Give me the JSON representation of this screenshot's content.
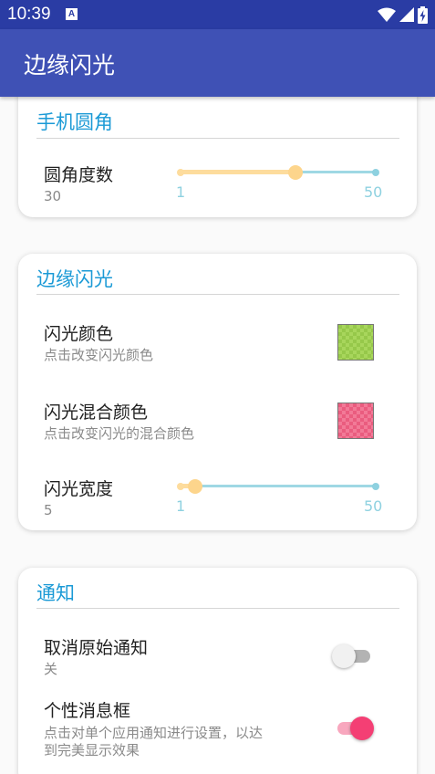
{
  "status_bar": {
    "time": "10:39",
    "notification_glyph": "A"
  },
  "app_bar": {
    "title": "边缘闪光"
  },
  "sections": {
    "corner": {
      "header": "手机圆角",
      "corner_degree": {
        "title": "圆角度数",
        "value": "30",
        "min": "1",
        "max": "50",
        "fraction": 0.59
      }
    },
    "edge_flash": {
      "header": "边缘闪光",
      "flash_color": {
        "title": "闪光颜色",
        "subtitle": "点击改变闪光颜色",
        "color": "#96c84a"
      },
      "mix_color": {
        "title": "闪光混合颜色",
        "subtitle": "点击改变闪光的混合颜色",
        "color": "#ea5c7f"
      },
      "flash_width": {
        "title": "闪光宽度",
        "value": "5",
        "min": "1",
        "max": "50",
        "fraction": 0.08
      }
    },
    "notification": {
      "header": "通知",
      "cancel_original": {
        "title": "取消原始通知",
        "subtitle": "关",
        "on": false
      },
      "custom_box": {
        "title": "个性消息框",
        "subtitle_line1": "点击对单个应用通知进行设置，以达",
        "subtitle_line2": "到完美显示效果",
        "on": true
      }
    }
  },
  "colors": {
    "status_bar": "#2a3ca4",
    "app_bar": "#3f51b5",
    "header_text": "#1b9ad6",
    "slider_track": "#9fd8e4",
    "slider_active": "#fddc9d",
    "switch_on": "#f43f74"
  }
}
